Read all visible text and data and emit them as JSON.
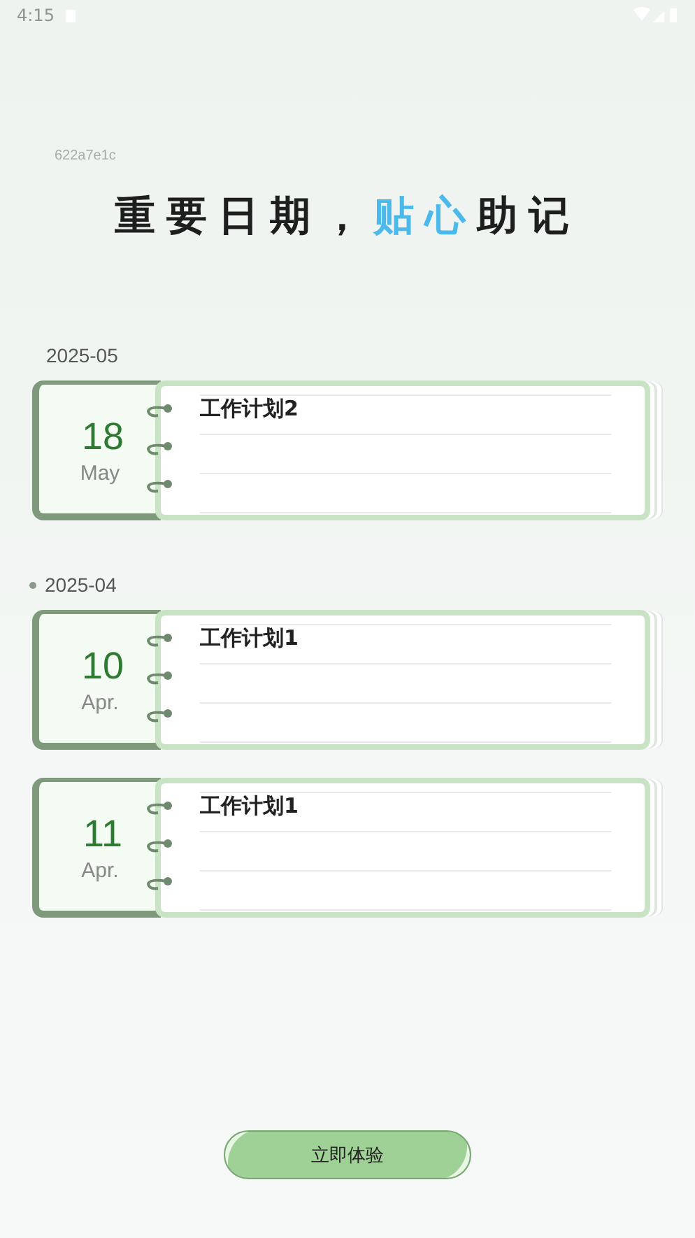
{
  "status_bar": {
    "time": "4:15"
  },
  "code": "622a7e1c",
  "headline": [
    {
      "text": "重要日期，",
      "accent": false
    },
    {
      "text": "贴心",
      "accent": true
    },
    {
      "text": "助记",
      "accent": false
    }
  ],
  "groups": [
    {
      "month": "2025-05",
      "dot": false,
      "entries": [
        {
          "day": "18",
          "month_name": "May",
          "title": "工作计划2"
        }
      ]
    },
    {
      "month": "2025-04",
      "dot": true,
      "entries": [
        {
          "day": "10",
          "month_name": "Apr.",
          "title": "工作计划1"
        },
        {
          "day": "11",
          "month_name": "Apr.",
          "title": "工作计划1"
        }
      ]
    }
  ],
  "button": "立即体验"
}
